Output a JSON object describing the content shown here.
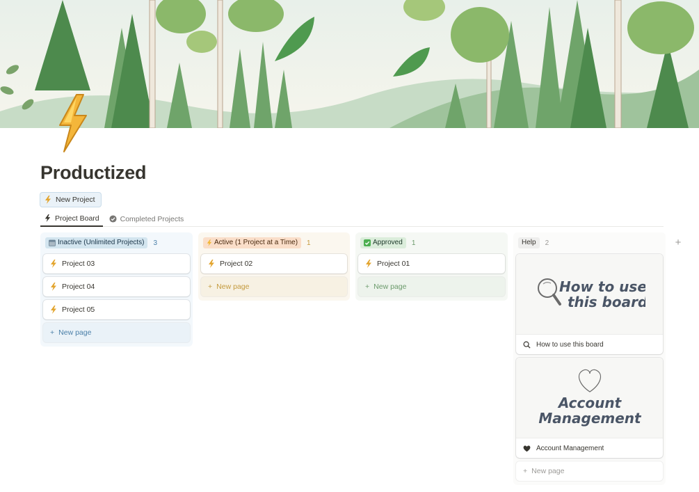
{
  "page": {
    "title": "Productized"
  },
  "toolbar": {
    "new_project_label": "New Project"
  },
  "tabs": [
    {
      "label": "Project Board",
      "icon": "bolt-icon",
      "active": true
    },
    {
      "label": "Completed Projects",
      "icon": "check-circle-icon",
      "active": false
    }
  ],
  "board": {
    "columns": [
      {
        "name": "Inactive (Unlimited Projects)",
        "count": "3",
        "color": "#d3e5ef",
        "cards": [
          "Project 03",
          "Project 04",
          "Project 05"
        ],
        "new_label": "New page"
      },
      {
        "name": "Active (1 Project at a Time)",
        "count": "1",
        "color": "#fadec9",
        "cards": [
          "Project 02"
        ],
        "new_label": "New page"
      },
      {
        "name": "Approved",
        "count": "1",
        "color": "#dbeddb",
        "cards": [
          "Project 01"
        ],
        "new_label": "New page"
      },
      {
        "name": "Help",
        "count": "2",
        "color": "#eeeeed",
        "gallery": [
          {
            "preview_line1": "How to use",
            "preview_line2": "this board",
            "label": "How to use this board",
            "icon": "search-icon"
          },
          {
            "preview_line1": "Account",
            "preview_line2": "Management",
            "label": "Account Management",
            "icon": "heart-icon"
          }
        ],
        "new_label": "New page"
      }
    ],
    "add_column_label": "+"
  },
  "colors": {
    "accent_bolt": "#f2b632",
    "text": "#37352f",
    "muted": "#787774"
  }
}
